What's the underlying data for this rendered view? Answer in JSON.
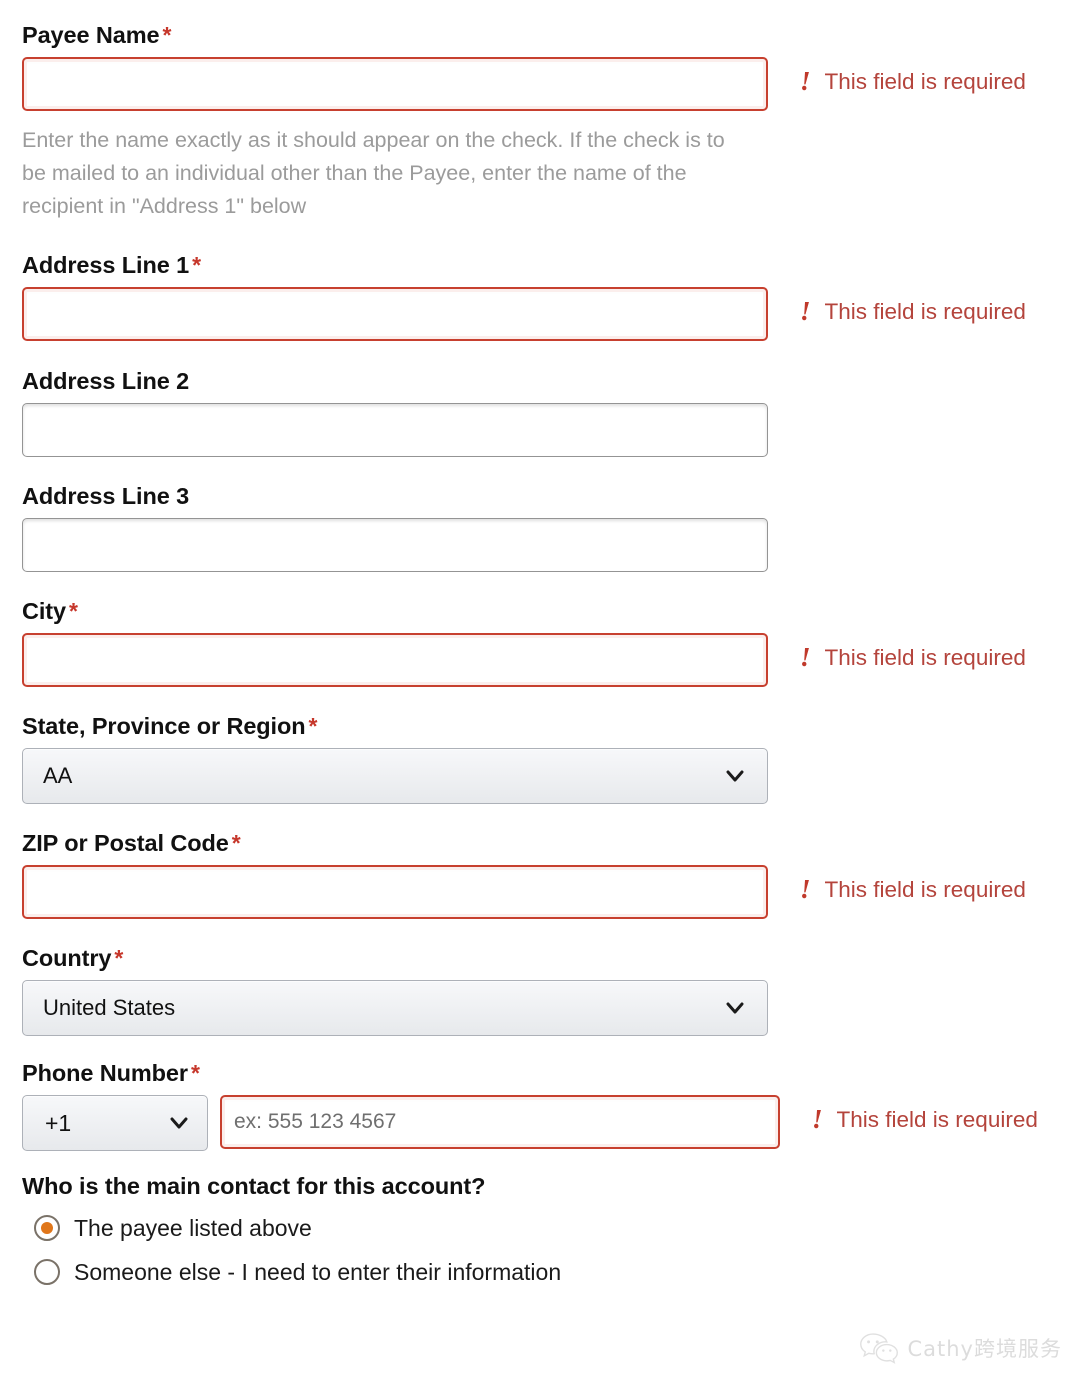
{
  "form": {
    "fields": [
      {
        "id": "payee-name",
        "label": "Payee Name",
        "required_marker": "*",
        "required": true,
        "type": "text",
        "value": "",
        "placeholder": "",
        "error": "This field is required",
        "error_icon": "exclamation-icon",
        "helper": "Enter the name exactly as it should appear on the check. If the check is to be mailed to an individual other than the Payee, enter the name of the recipient in \"Address 1\" below"
      },
      {
        "id": "address-line-1",
        "label": "Address Line 1",
        "required_marker": "*",
        "required": true,
        "type": "text",
        "value": "",
        "placeholder": "",
        "error": "This field is required",
        "error_icon": "exclamation-icon"
      },
      {
        "id": "address-line-2",
        "label": "Address Line 2",
        "required_marker": "",
        "required": false,
        "type": "text",
        "value": "",
        "placeholder": "",
        "error": ""
      },
      {
        "id": "address-line-3",
        "label": "Address Line 3",
        "required_marker": "",
        "required": false,
        "type": "text",
        "value": "",
        "placeholder": "",
        "error": ""
      },
      {
        "id": "city",
        "label": "City",
        "required_marker": "*",
        "required": true,
        "type": "text",
        "value": "",
        "placeholder": "",
        "error": "This field is required",
        "error_icon": "exclamation-icon"
      },
      {
        "id": "state-province-region",
        "label": "State, Province or Region",
        "required_marker": "*",
        "required": true,
        "type": "select",
        "value": "AA",
        "error": "",
        "dropdown_icon": "chevron-down-icon"
      },
      {
        "id": "zip-postal-code",
        "label": "ZIP or Postal Code",
        "required_marker": "*",
        "required": true,
        "type": "text",
        "value": "",
        "placeholder": "",
        "error": "This field is required",
        "error_icon": "exclamation-icon"
      },
      {
        "id": "country",
        "label": "Country",
        "required_marker": "*",
        "required": true,
        "type": "select",
        "value": "United States",
        "error": "",
        "dropdown_icon": "chevron-down-icon"
      },
      {
        "id": "phone-number",
        "label": "Phone Number",
        "required_marker": "*",
        "required": true,
        "type": "phone",
        "country_code": "+1",
        "country_code_icon": "chevron-down-icon",
        "value": "",
        "placeholder": "ex: 555 123 4567",
        "error": "This field is required",
        "error_icon": "exclamation-icon"
      }
    ],
    "contact_question": {
      "title": "Who is the main contact for this account?",
      "options": [
        {
          "label": "The payee listed above",
          "checked": true
        },
        {
          "label": "Someone else - I need to enter their information",
          "checked": false
        }
      ]
    }
  },
  "watermark": {
    "icon": "wechat-logo-icon",
    "text": "Cathy跨境服务"
  },
  "colors": {
    "error_border": "#c7402f",
    "error_text": "#b4443c",
    "required_star": "#c6372b",
    "radio_selected": "#e0761a",
    "label_text": "#111111",
    "helper_text": "#9b9b9b",
    "input_border": "#949494"
  }
}
